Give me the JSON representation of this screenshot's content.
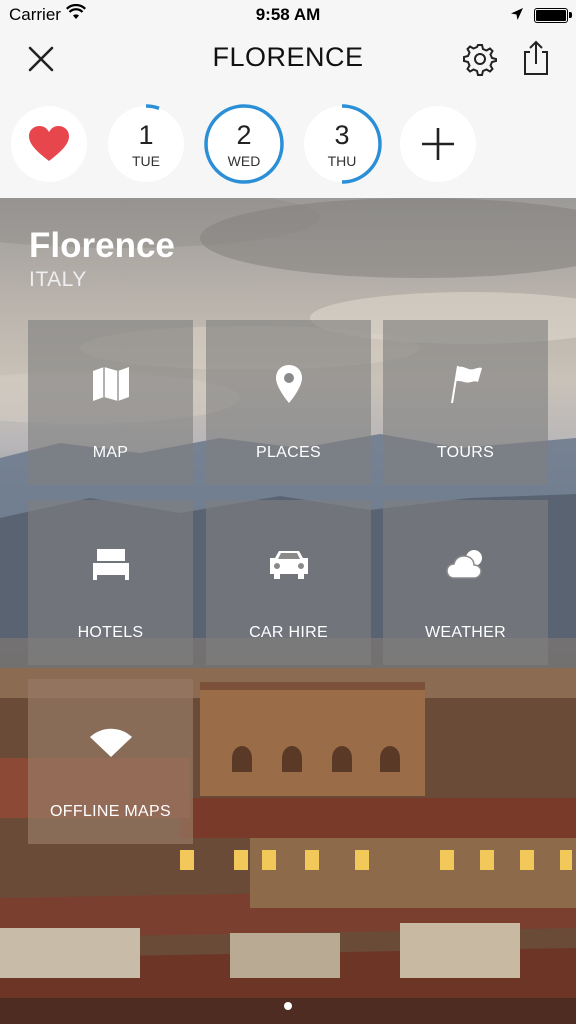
{
  "status_bar": {
    "carrier": "Carrier",
    "time": "9:58 AM"
  },
  "nav": {
    "title": "FLORENCE",
    "close_icon": "close-icon",
    "settings_icon": "gear-icon",
    "share_icon": "share-icon"
  },
  "days": {
    "favorites_icon": "heart-icon",
    "add_icon": "plus-icon",
    "items": [
      {
        "number": "1",
        "weekday": "TUE"
      },
      {
        "number": "2",
        "weekday": "WED"
      },
      {
        "number": "3",
        "weekday": "THU"
      }
    ]
  },
  "hero": {
    "city": "Florence",
    "country": "ITALY"
  },
  "tiles": [
    {
      "label": "MAP",
      "icon": "map-icon"
    },
    {
      "label": "PLACES",
      "icon": "location-pin-icon"
    },
    {
      "label": "TOURS",
      "icon": "flag-icon"
    },
    {
      "label": "HOTELS",
      "icon": "bed-icon"
    },
    {
      "label": "CAR HIRE",
      "icon": "car-icon"
    },
    {
      "label": "WEATHER",
      "icon": "cloud-sun-icon"
    },
    {
      "label": "OFFLINE MAPS",
      "icon": "wifi-icon"
    }
  ],
  "colors": {
    "accent": "#2a8fd6",
    "heart": "#e8464d"
  },
  "pager": {
    "pages": 1,
    "current": 1
  }
}
